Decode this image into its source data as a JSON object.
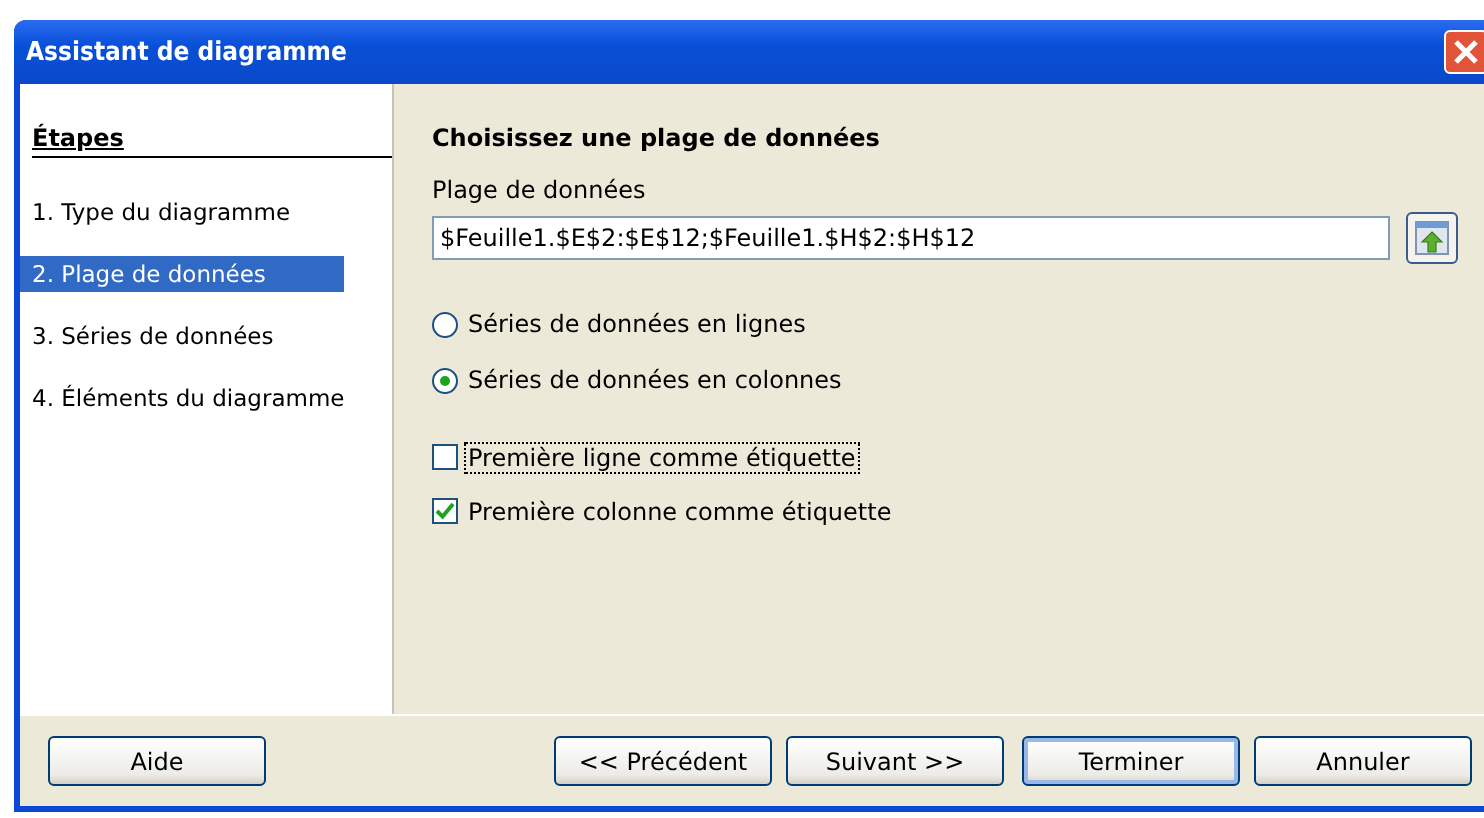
{
  "window": {
    "title": "Assistant de diagramme"
  },
  "steps": {
    "title": "Étapes",
    "items": [
      {
        "label": "1. Type du diagramme",
        "selected": false
      },
      {
        "label": "2. Plage de données",
        "selected": true
      },
      {
        "label": "3. Séries de données",
        "selected": false
      },
      {
        "label": "4. Éléments du diagramme",
        "selected": false
      }
    ]
  },
  "content": {
    "heading": "Choisissez une plage de données",
    "range_label": "Plage de données",
    "range_value": "$Feuille1.$E$2:$E$12;$Feuille1.$H$2:$H$12",
    "options": [
      {
        "kind": "radio",
        "label": "Séries de données en lignes",
        "selected": false
      },
      {
        "kind": "radio",
        "label": "Séries de données en colonnes",
        "selected": true
      },
      {
        "kind": "checkbox",
        "label": "Première ligne comme étiquette",
        "checked": false,
        "focused": true
      },
      {
        "kind": "checkbox",
        "label": "Première colonne comme étiquette",
        "checked": true,
        "focused": false
      }
    ]
  },
  "buttons": [
    {
      "label": "Aide",
      "default": false
    },
    {
      "label": "<< Précédent",
      "default": false
    },
    {
      "label": "Suivant >>",
      "default": false
    },
    {
      "label": "Terminer",
      "default": true
    },
    {
      "label": "Annuler",
      "default": false
    }
  ]
}
